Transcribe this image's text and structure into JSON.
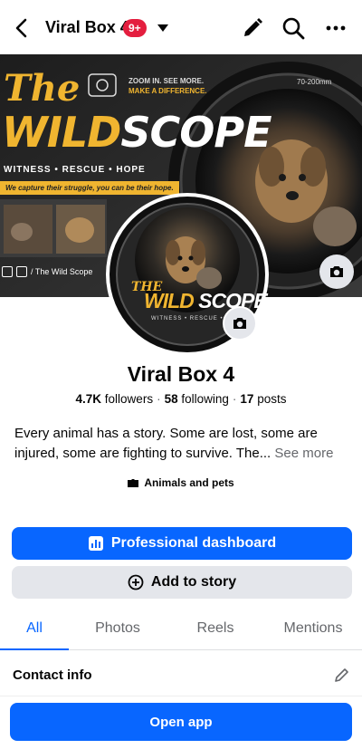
{
  "header": {
    "title": "Viral Box 4",
    "notification_badge": "9+",
    "icons": [
      "back-arrow-icon",
      "chevron-down-icon",
      "pencil-icon",
      "search-icon",
      "more-icon"
    ]
  },
  "cover": {
    "brand_the": "The",
    "brand_wild": "WILD",
    "brand_scope": "SCOPE",
    "tagline_zoom": "ZOOM IN. SEE MORE.",
    "tagline_difference": "MAKE A DIFFERENCE.",
    "witness_line": "WITNESS • RESCUE • HOPE",
    "capture_line": "We capture their struggle, you can be their hope.",
    "lens_label": "70-200mm",
    "social_handle": "/ The Wild Scope"
  },
  "avatar": {
    "the": "THE",
    "wild": "WILD",
    "scope": "SCOPE",
    "witness": "WITNESS • RESCUE • HOPE"
  },
  "profile": {
    "name": "Viral Box 4",
    "followers_count": "4.7K",
    "followers_label": "followers",
    "following_count": "58",
    "following_label": "following",
    "posts_count": "17",
    "posts_label": "posts",
    "bio": "Every animal has a story. Some are lost, some are injured, some are fighting to survive. The...",
    "see_more": "See more",
    "category": "Animals and pets"
  },
  "actions": {
    "dashboard": "Professional dashboard",
    "add_story": "Add to story"
  },
  "tabs": [
    {
      "label": "All",
      "active": true
    },
    {
      "label": "Photos",
      "active": false
    },
    {
      "label": "Reels",
      "active": false
    },
    {
      "label": "Mentions",
      "active": false
    }
  ],
  "contact": {
    "label": "Contact info"
  },
  "open_app": "Open app",
  "colors": {
    "accent": "#0866ff",
    "badge": "#e41e3f",
    "brand_gold": "#f0b530"
  }
}
